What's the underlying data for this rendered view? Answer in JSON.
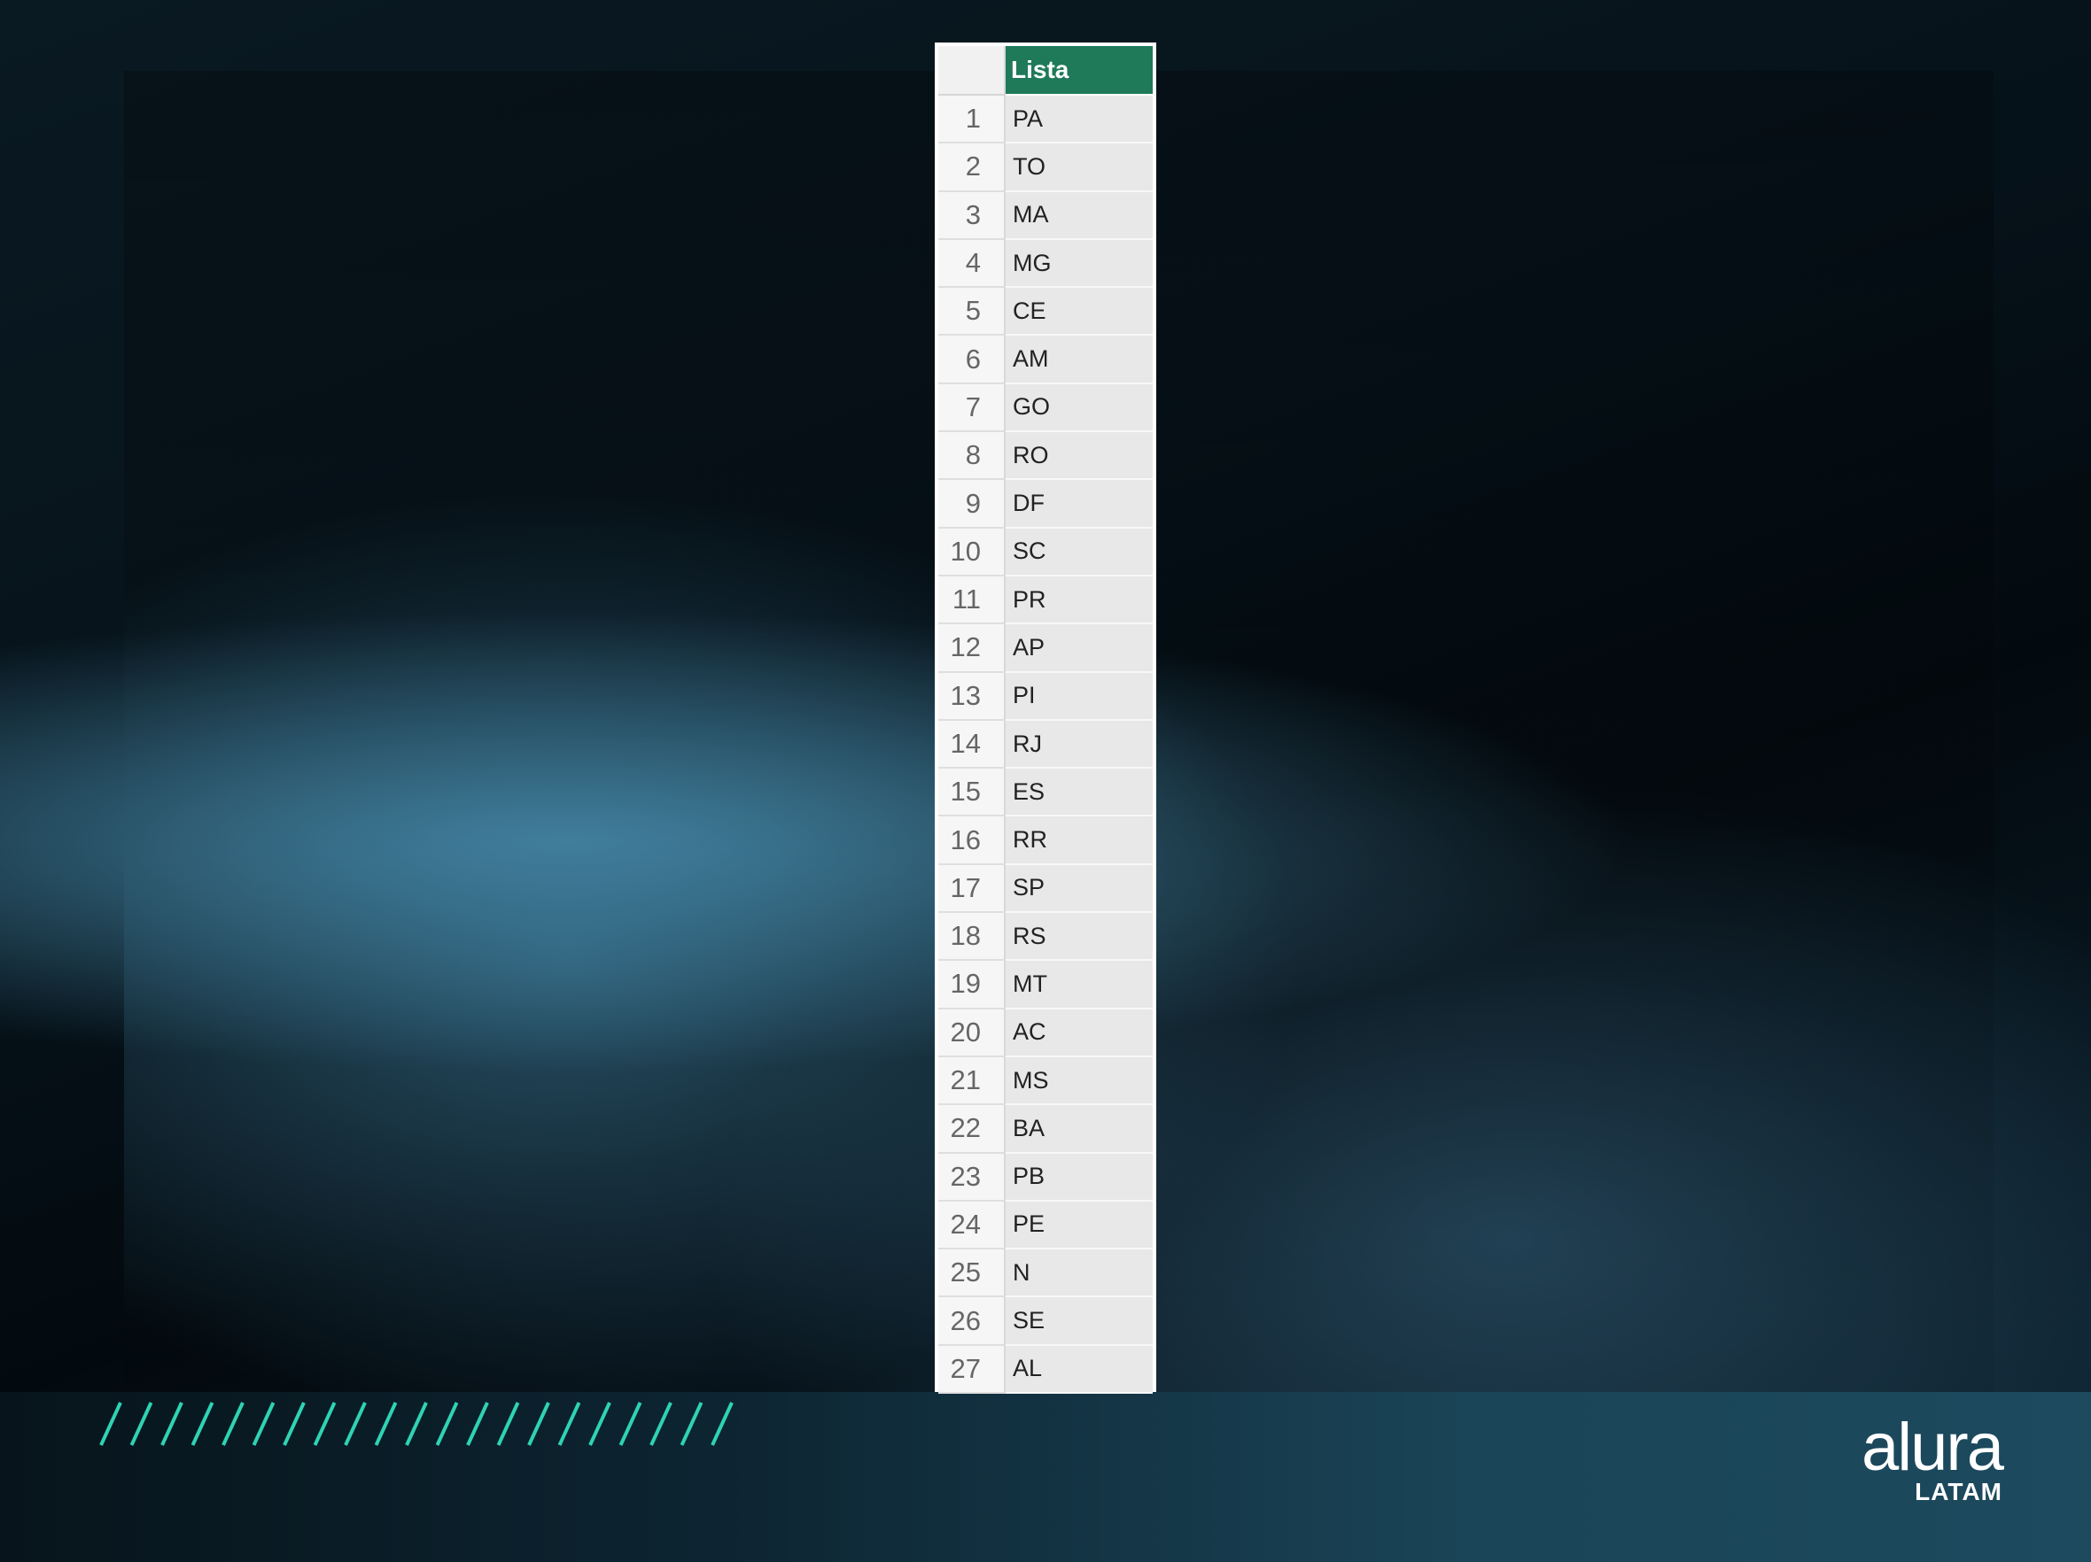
{
  "table": {
    "column_header": "Lista",
    "rows": [
      {
        "n": "1",
        "v": "PA"
      },
      {
        "n": "2",
        "v": "TO"
      },
      {
        "n": "3",
        "v": "MA"
      },
      {
        "n": "4",
        "v": "MG"
      },
      {
        "n": "5",
        "v": "CE"
      },
      {
        "n": "6",
        "v": "AM"
      },
      {
        "n": "7",
        "v": "GO"
      },
      {
        "n": "8",
        "v": "RO"
      },
      {
        "n": "9",
        "v": "DF"
      },
      {
        "n": "10",
        "v": "SC"
      },
      {
        "n": "11",
        "v": "PR"
      },
      {
        "n": "12",
        "v": "AP"
      },
      {
        "n": "13",
        "v": "PI"
      },
      {
        "n": "14",
        "v": "RJ"
      },
      {
        "n": "15",
        "v": "ES"
      },
      {
        "n": "16",
        "v": "RR"
      },
      {
        "n": "17",
        "v": "SP"
      },
      {
        "n": "18",
        "v": "RS"
      },
      {
        "n": "19",
        "v": "MT"
      },
      {
        "n": "20",
        "v": "AC"
      },
      {
        "n": "21",
        "v": "MS"
      },
      {
        "n": "22",
        "v": "BA"
      },
      {
        "n": "23",
        "v": "PB"
      },
      {
        "n": "24",
        "v": "PE"
      },
      {
        "n": "25",
        "v": "N"
      },
      {
        "n": "26",
        "v": "SE"
      },
      {
        "n": "27",
        "v": "AL"
      }
    ]
  },
  "brand": {
    "name": "alura",
    "region": "LATAM"
  },
  "colors": {
    "header_fill": "#1f7a5a",
    "hatch": "#2fd3b4",
    "background": "#06121a"
  }
}
